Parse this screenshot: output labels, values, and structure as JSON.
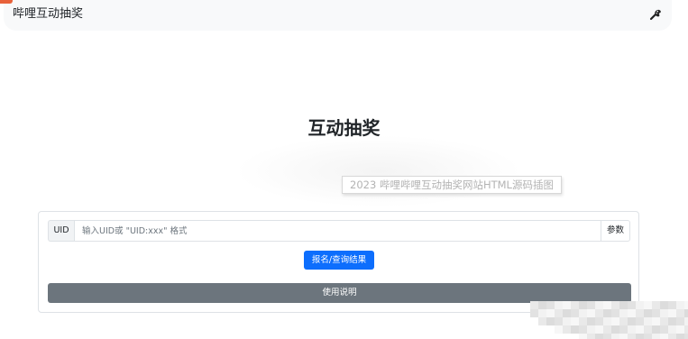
{
  "navbar": {
    "brand": "哔哩互动抽奖",
    "theme_icon": "palette-icon"
  },
  "main": {
    "title": "互动抽奖"
  },
  "watermark": {
    "text": "2023 哔哩哔哩互动抽奖网站HTML源码插图"
  },
  "form": {
    "uid_label": "UID",
    "uid_value": "",
    "uid_placeholder": "输入UID或 \"UID:xxx\" 格式",
    "params_label": "参数",
    "submit_label": "报名/查询结果",
    "help_label": "使用说明"
  },
  "colors": {
    "primary": "#0d6efd",
    "secondary": "#6c757d",
    "navbar_bg": "#f8f9fa",
    "corner_badge": "#e8613a"
  }
}
